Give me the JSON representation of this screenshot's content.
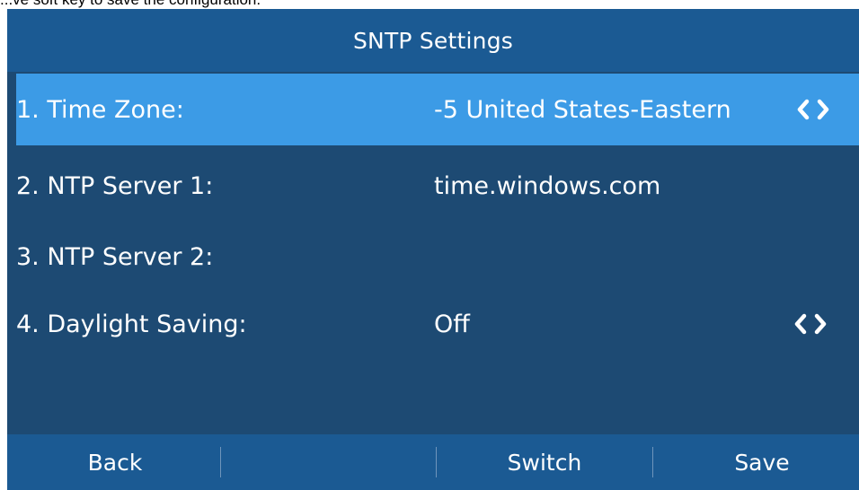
{
  "caption": "...ve soft key to save the configuration.",
  "header": {
    "title": "SNTP Settings"
  },
  "items": [
    {
      "label": "1. Time Zone:",
      "value": "-5 United States-Eastern"
    },
    {
      "label": "2. NTP Server 1:",
      "value": "time.windows.com"
    },
    {
      "label": "3. NTP Server 2:",
      "value": ""
    },
    {
      "label": "4. Daylight Saving:",
      "value": "Off"
    }
  ],
  "softkeys": {
    "back": "Back",
    "switch": "Switch",
    "save": "Save"
  },
  "icons": {
    "left": "chevron-left-icon",
    "right": "chevron-right-icon"
  },
  "colors": {
    "screen_bg": "#1d4a73",
    "bar_bg": "#1b5a93",
    "highlight": "#3c9be6",
    "text": "#ffffff"
  }
}
